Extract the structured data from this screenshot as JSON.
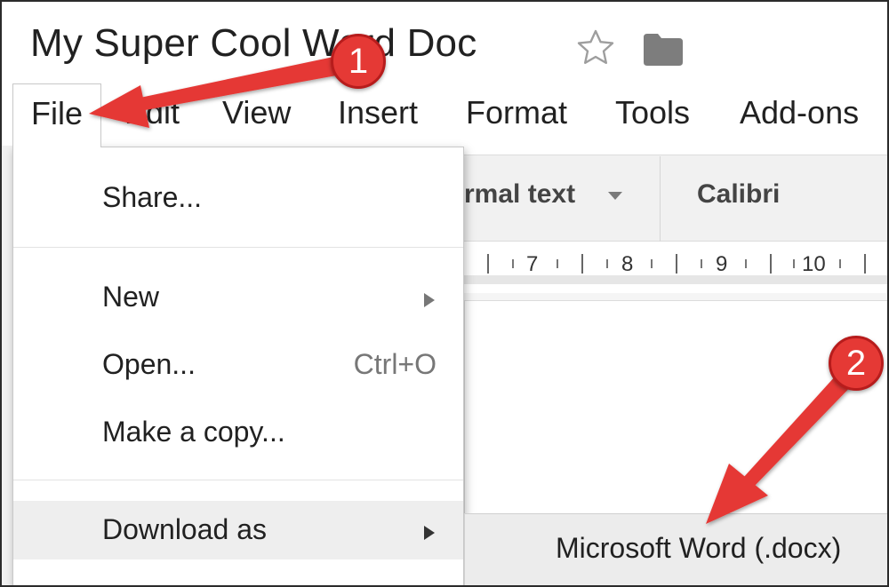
{
  "document": {
    "title": "My Super Cool Word Doc"
  },
  "icons": {
    "star": "star-outline-icon",
    "folder": "folder-icon"
  },
  "menubar": {
    "items": [
      "File",
      "Edit",
      "View",
      "Insert",
      "Format",
      "Tools",
      "Add-ons"
    ]
  },
  "toolbar": {
    "style_value": "rmal text",
    "font_value": "Calibri"
  },
  "ruler": {
    "labels": [
      "7",
      "8",
      "9",
      "10"
    ]
  },
  "file_menu": {
    "share_label": "Share...",
    "new_label": "New",
    "open_label": "Open...",
    "open_shortcut": "Ctrl+O",
    "copy_label": "Make a copy...",
    "download_label": "Download as"
  },
  "download_submenu": {
    "item_label": "Microsoft Word (.docx)"
  },
  "annotations": {
    "callout_1": "1",
    "callout_2": "2",
    "arrow_color": "#e53935"
  }
}
